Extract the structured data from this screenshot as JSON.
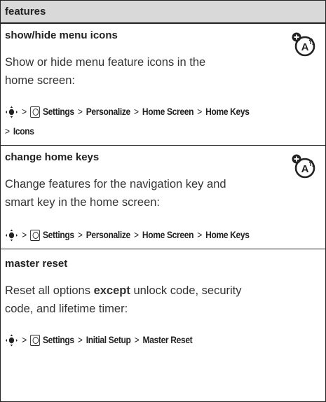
{
  "header": {
    "title": "features"
  },
  "sections": [
    {
      "title": "show/hide menu icons",
      "description_lines": [
        "Show or hide menu feature icons in the",
        "home screen:"
      ],
      "path_line1": {
        "settings": "Settings",
        "steps": [
          "Personalize",
          "Home Screen",
          "Home Keys"
        ]
      },
      "path_line2": {
        "steps": [
          "Icons"
        ]
      },
      "has_feature_icon": true
    },
    {
      "title": "change home keys",
      "description_lines": [
        "Change features for the navigation key and",
        "smart key in the home screen:"
      ],
      "path_line1": {
        "settings": "Settings",
        "steps": [
          "Personalize",
          "Home Screen",
          "Home Keys"
        ]
      },
      "has_feature_icon": true
    },
    {
      "title": "master reset",
      "description_line1": {
        "pre": "Reset all options ",
        "bold": "except",
        "post": " unlock code, security"
      },
      "description_line2": "code, and lifetime timer:",
      "path_line1": {
        "settings": "Settings",
        "steps": [
          "Initial Setup",
          "Master Reset"
        ]
      },
      "has_feature_icon": false
    }
  ],
  "symbols": {
    "separator": ">"
  },
  "icons": {
    "feature_icon": "network-feature-icon",
    "nav_icon": "nav-key-icon",
    "settings_icon": "settings-icon"
  }
}
